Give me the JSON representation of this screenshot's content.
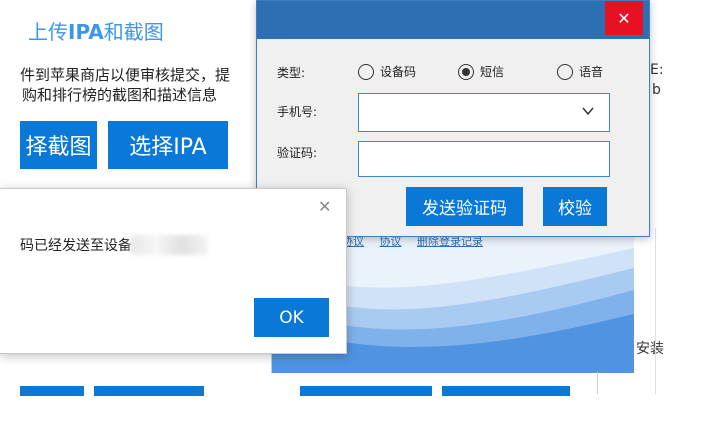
{
  "main": {
    "title_prefix": "上传",
    "title_bold": "IPA",
    "title_suffix": "和截图",
    "desc_line1": "件到苹果商店以便审核提交，提",
    "desc_line2": "购和排行榜的截图和描述信息",
    "select_screenshot_label": "择截图",
    "select_ipa_label": "选择IPA",
    "right_fragment_top": "E:",
    "right_fragment_mid": "b",
    "right_fragment_install": "安装",
    "links": [
      "协议",
      "协议",
      "删除登录记录"
    ]
  },
  "sms_dialog": {
    "close_symbol": "✕",
    "type_label": "类型:",
    "radio_options": [
      {
        "label": "设备码",
        "checked": false
      },
      {
        "label": "短信",
        "checked": true
      },
      {
        "label": "语音",
        "checked": false
      }
    ],
    "phone_label": "手机号:",
    "phone_value": "",
    "code_label": "验证码:",
    "code_value": "",
    "send_button": "发送验证码",
    "verify_button": "校验"
  },
  "message_box": {
    "close_symbol": "✕",
    "text": "码已经发送至设备",
    "ok_button": "OK"
  },
  "colors": {
    "primary": "#0a78d6",
    "titlebar": "#2d6fb3",
    "close_red": "#e81123"
  }
}
